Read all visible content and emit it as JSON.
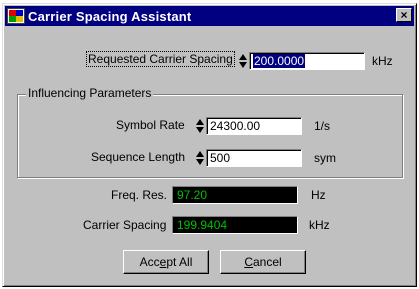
{
  "window": {
    "title": "Carrier Spacing Assistant",
    "close_label": "×"
  },
  "requested": {
    "label": "Requested Carrier Spacing",
    "value": "200.0000",
    "unit": "kHz"
  },
  "group": {
    "title": "Influencing Parameters",
    "symbol_rate": {
      "label": "Symbol  Rate",
      "value": "24300.00",
      "unit": "1/s"
    },
    "sequence_length": {
      "label": "Sequence Length",
      "value": "500",
      "unit": "sym"
    }
  },
  "freq_res": {
    "label": "Freq. Res.",
    "value": "97.20",
    "unit": "Hz"
  },
  "carrier_spacing": {
    "label": "Carrier Spacing",
    "value": "199.9404",
    "unit": "kHz"
  },
  "buttons": {
    "accept_pre": "Acc",
    "accept_mnemonic": "e",
    "accept_post": "pt All",
    "cancel_mnemonic": "C",
    "cancel_post": "ancel"
  },
  "colors": {
    "titlebar": "#000080",
    "readout_bg": "#000000",
    "readout_fg": "#00c000"
  }
}
